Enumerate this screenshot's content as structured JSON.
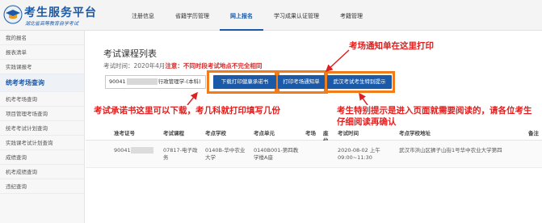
{
  "header": {
    "brand_title": "考生服务平台",
    "brand_sub": "湖北省高等教育自学考试",
    "nav": [
      "注册信息",
      "省籍学历管理",
      "网上报名",
      "学习成果认证管理",
      "考籍管理"
    ],
    "active_nav_index": 2
  },
  "sidebar": {
    "items_top": [
      "我的报名",
      "报表清单",
      "实践课报考"
    ],
    "group": "统考考场查询",
    "items_bottom": [
      "机考考场查询",
      "项目管理考场查询",
      "统考考试计划查询",
      "实践课考试计划查询",
      "成绩查询",
      "机考成绩查询",
      "违纪查询"
    ]
  },
  "main": {
    "title": "考试课程列表",
    "exam_time_label": "考试时间：",
    "exam_time_value": "2020年4月",
    "exam_time_note": "注意：不同时段考试地点不完全相同",
    "program_prefix": "90041",
    "program_suffix": "行政管理学-(本科)",
    "buttons": {
      "health": "下载打印健康承诺书",
      "admit": "打印考场通知单",
      "special": "武汉考试考生特别提示"
    },
    "table": {
      "headers": [
        "准考证号",
        "考试课程",
        "考点学校",
        "考点单元",
        "考场",
        "座位号",
        "考试时间",
        "考点学校地址",
        "备注"
      ],
      "row": {
        "ticket_prefix": "90041",
        "course": "07817-电子政务",
        "school": "0140B-华中农业大学",
        "unit": "0140B001-第四教学楼A座",
        "room": "",
        "seat": "",
        "time": "2020-08-02 上午 09:00~11:30",
        "address": "武汉市洪山区狮子山街1号华中农业大学第四",
        "remark": ""
      }
    }
  },
  "annotations": {
    "admit": "考场通知单在这里打印",
    "pledge": "考试承诺书这里可以下载，考几科就打印填写几份",
    "special": "考生特别提示是进入页面就需要阅读的，请各位考生仔细阅读再确认"
  },
  "colors": {
    "brand": "#1a5aa8",
    "highlight": "#f07d1a",
    "alert": "#e02020"
  }
}
